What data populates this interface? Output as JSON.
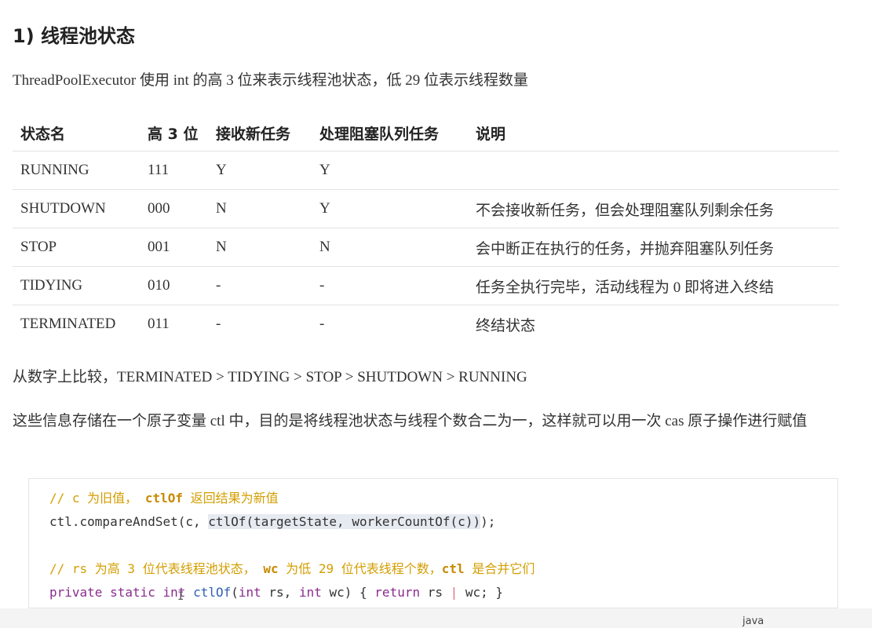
{
  "section_title": "1) 线程池状态",
  "intro": "ThreadPoolExecutor 使用 int 的高 3 位来表示线程池状态，低 29 位表示线程数量",
  "table": {
    "headers": [
      "状态名",
      "高 3 位",
      "接收新任务",
      "处理阻塞队列任务",
      "说明"
    ],
    "rows": [
      [
        "RUNNING",
        "111",
        "Y",
        "Y",
        ""
      ],
      [
        "SHUTDOWN",
        "000",
        "N",
        "Y",
        "不会接收新任务，但会处理阻塞队列剩余任务"
      ],
      [
        "STOP",
        "001",
        "N",
        "N",
        "会中断正在执行的任务，并抛弃阻塞队列任务"
      ],
      [
        "TIDYING",
        "010",
        "-",
        "-",
        "任务全执行完毕，活动线程为 0 即将进入终结"
      ],
      [
        "TERMINATED",
        "011",
        "-",
        "-",
        "终结状态"
      ]
    ]
  },
  "compare": "从数字上比较，TERMINATED > TIDYING > STOP > SHUTDOWN > RUNNING",
  "info": "这些信息存储在一个原子变量 ctl 中，目的是将线程池状态与线程个数合二为一，这样就可以用一次 cas 原子操作进行赋值",
  "code": {
    "line1_comment_a": "// c 为旧值， ",
    "line1_comment_fn": "ctlOf",
    "line1_comment_b": " 返回结果为新值",
    "line2_prefix": "ctl.compareAndSet(c, ",
    "line2_highlight": "ctlOf(targetState, workerCountOf(c))",
    "line2_suffix": ");",
    "line3_comment_a": "// rs 为高 3 位代表线程池状态， ",
    "line3_comment_wc": "wc",
    "line3_comment_b": " 为低 29 位代表线程个数，",
    "line3_comment_ctl": "ctl",
    "line3_comment_c": " 是合并它们",
    "line4_kw1": "private",
    "line4_kw2": "static",
    "line4_kw3": "int",
    "line4_fn": "ctlOf",
    "line4_p1": "(",
    "line4_kw4": "int",
    "line4_p2": " rs, ",
    "line4_kw5": "int",
    "line4_p3": " wc) { ",
    "line4_kw6": "return",
    "line4_p4": " rs ",
    "line4_bar": "|",
    "line4_p5": " wc; }",
    "language": "java"
  },
  "cursor_glyph": "I",
  "colors": {
    "comment": "#d39e00",
    "keyword": "#8a2c8f",
    "function": "#2f5fb3",
    "highlight": "#e6eaf1"
  }
}
